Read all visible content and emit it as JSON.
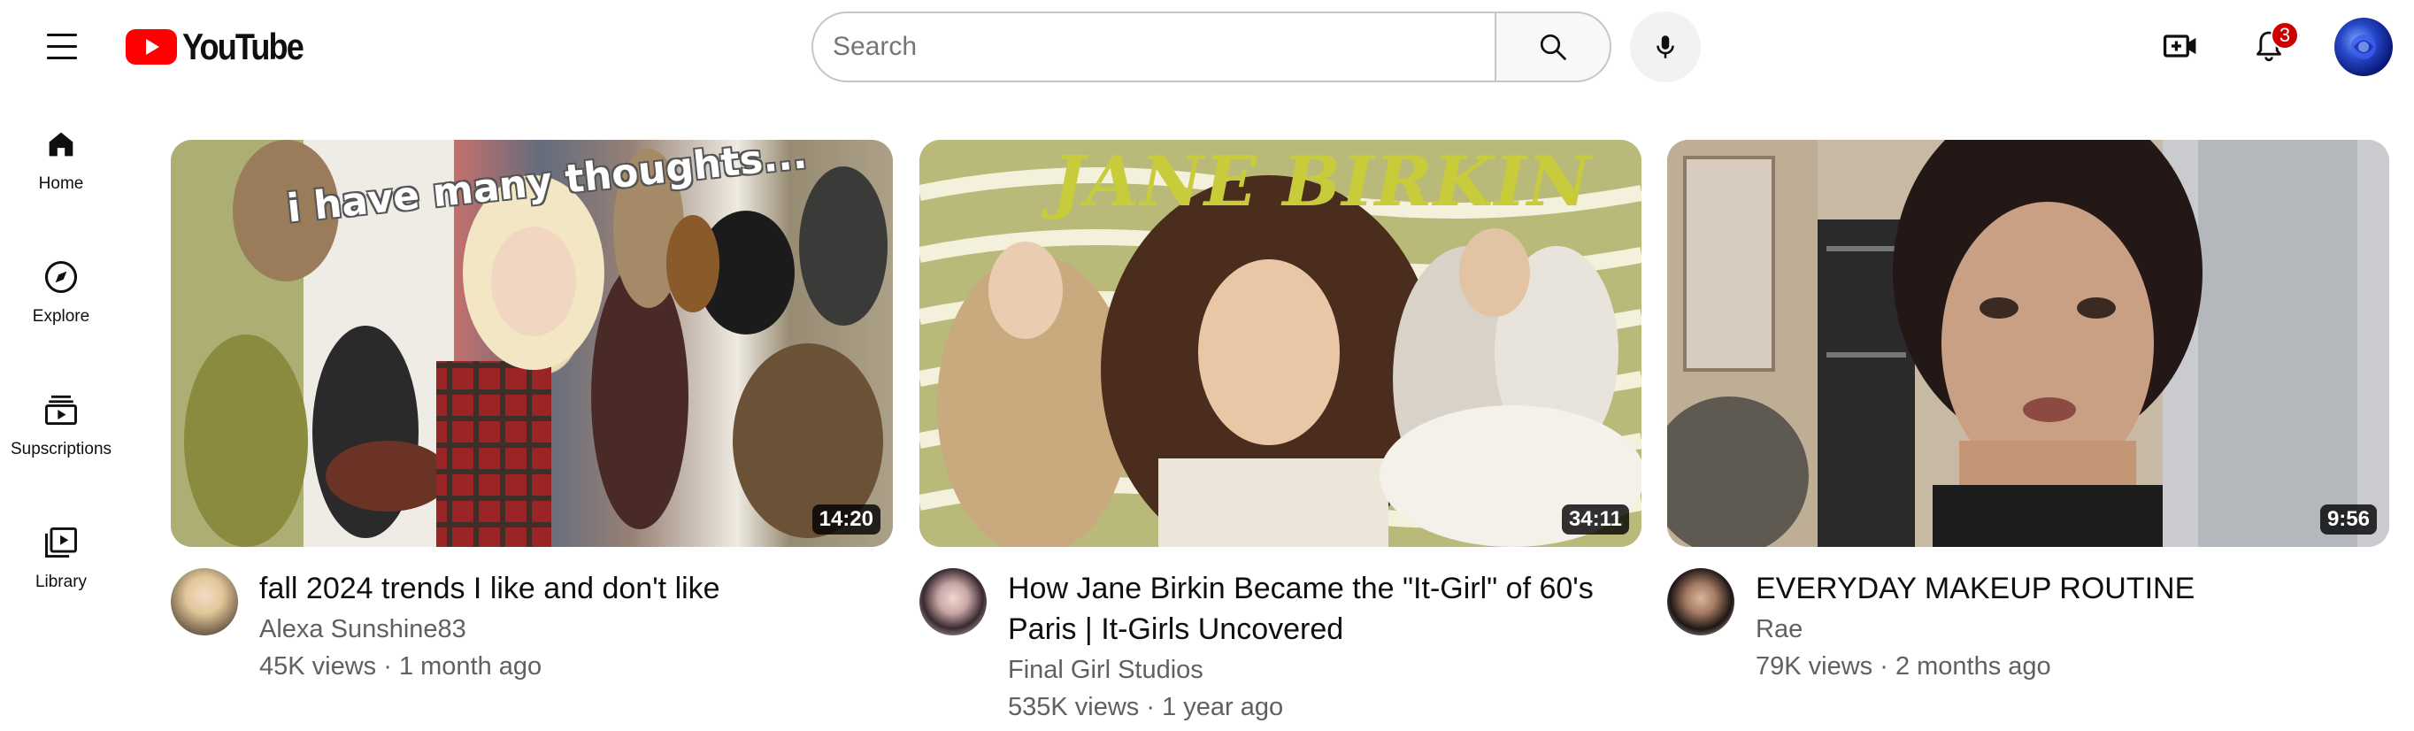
{
  "header": {
    "logo_text": "YouTube",
    "search_placeholder": "Search",
    "notification_count": "3"
  },
  "sidebar": {
    "items": [
      {
        "label": "Home",
        "icon": "home-icon"
      },
      {
        "label": "Explore",
        "icon": "compass-icon"
      },
      {
        "label": "Supscriptions",
        "icon": "subscriptions-icon"
      },
      {
        "label": "Library",
        "icon": "library-icon"
      }
    ]
  },
  "videos": [
    {
      "title": "fall 2024 trends I like and don't like",
      "channel": "Alexa Sunshine83",
      "views": "45K views",
      "age": "1 month ago",
      "duration": "14:20",
      "overlay_text": "i have many thoughts..."
    },
    {
      "title": "How Jane Birkin Became the \"It-Girl\" of 60's Paris | It-Girls Uncovered",
      "channel": "Final Girl Studios",
      "views": "535K views",
      "age": "1 year ago",
      "duration": "34:11",
      "overlay_text": "JANE BIRKIN"
    },
    {
      "title": "EVERYDAY MAKEUP ROUTINE",
      "channel": "Rae",
      "views": "79K views",
      "age": "2 months ago",
      "duration": "9:56",
      "overlay_text": ""
    }
  ],
  "colors": {
    "brand_red": "#ff0000",
    "badge_red": "#cc0000",
    "text_primary": "#0f0f0f",
    "text_secondary": "#606060",
    "jane_birkin_title": "#c8cc3a"
  }
}
